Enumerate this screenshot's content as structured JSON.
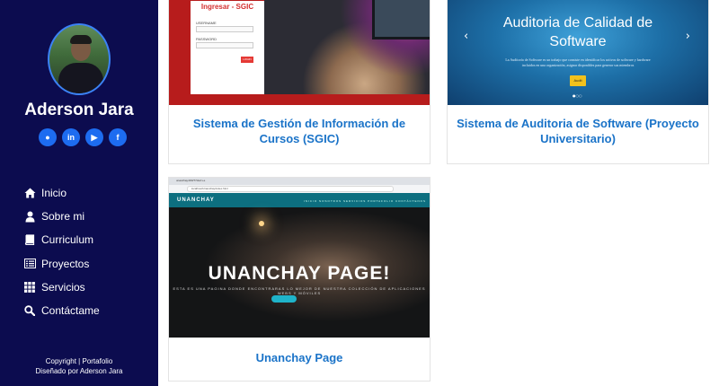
{
  "profile": {
    "name": "Aderson Jara",
    "socials": [
      {
        "icon": "github-icon",
        "glyph": "●"
      },
      {
        "icon": "linkedin-icon",
        "glyph": "in"
      },
      {
        "icon": "youtube-icon",
        "glyph": "▶"
      },
      {
        "icon": "facebook-icon",
        "glyph": "f"
      }
    ]
  },
  "nav": [
    {
      "label": "Inicio",
      "icon": "home-icon"
    },
    {
      "label": "Sobre mi",
      "icon": "user-icon"
    },
    {
      "label": "Curriculum",
      "icon": "book-icon"
    },
    {
      "label": "Proyectos",
      "icon": "list-icon"
    },
    {
      "label": "Servicios",
      "icon": "grid-icon"
    },
    {
      "label": "Contáctame",
      "icon": "search-icon"
    }
  ],
  "footer": {
    "line1": "Copyright | Portafolio",
    "line2": "Diseñado por Aderson Jara"
  },
  "projects": [
    {
      "title": "Sistema de Gestión de Información de Cursos (SGIC)",
      "preview": {
        "heading": "Ingresar - SGIC",
        "field1": "USERNAME",
        "field2": "PASSWORD",
        "button": "LOGIN"
      }
    },
    {
      "title": "Sistema de Auditoria de Software (Proyecto Universitario)",
      "preview": {
        "heading": "Auditoria de Calidad de Software",
        "text": "La Auditoría de Software es un trabajo que consiste en identificar los activos de software y hardware incluidos en una organización, asignar disponibles para generar sus miembros",
        "button": "Audit",
        "prev": "‹",
        "next": "›",
        "dots": "●○○"
      }
    },
    {
      "title": "Unanchay Page",
      "preview": {
        "tab": "unanchay.000/77dsd v.e",
        "url": "localhost/Unanchay/index.html",
        "brand": "UNANCHAY",
        "menu": "INICIO   NOSOTROS   SERVICIOS   PORTAFOLIO   CONTÁCTENOS",
        "heading": "UNANCHAY PAGE!",
        "subheading": "ESTA ES UNA PAGINA DONDE ENCONTRARAS LO MEJOR DE NUESTRA COLECCIÓN DE APLICACIONES WEBS Y MÓVILES"
      }
    }
  ]
}
